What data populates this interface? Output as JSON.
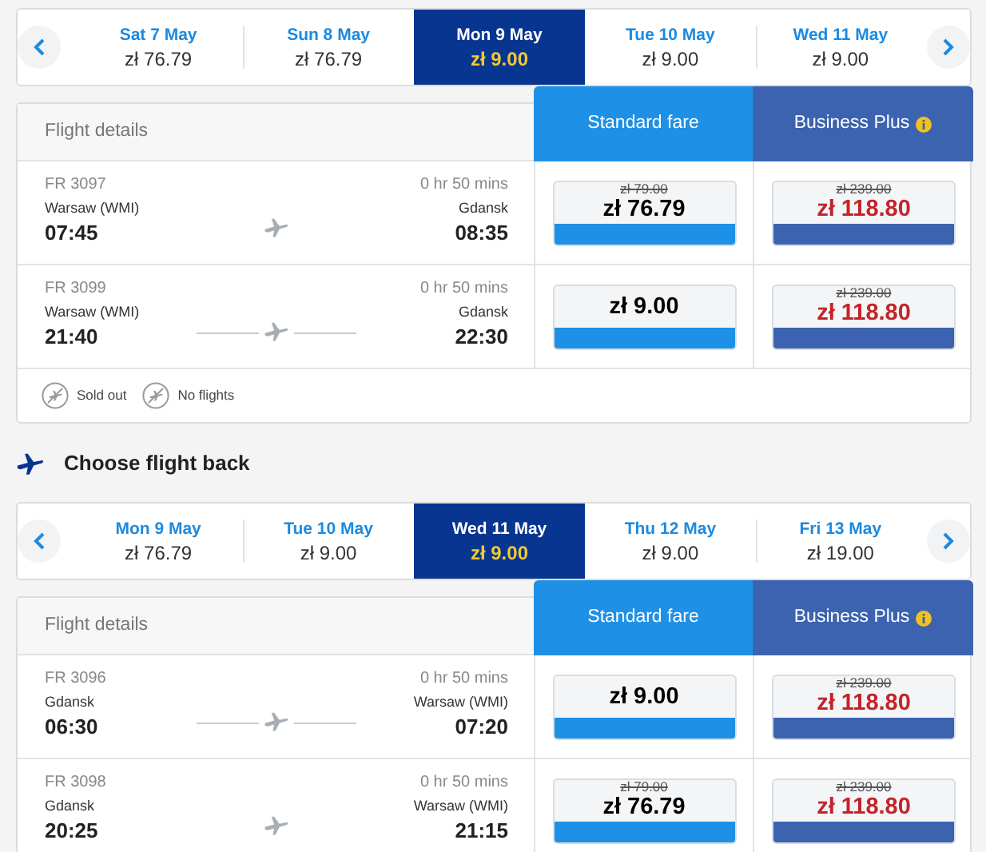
{
  "outbound": {
    "dates": [
      {
        "day": "Sat 7 May",
        "price": "zł 76.79",
        "selected": false
      },
      {
        "day": "Sun 8 May",
        "price": "zł 76.79",
        "selected": false
      },
      {
        "day": "Mon 9 May",
        "price": "zł 9.00",
        "selected": true
      },
      {
        "day": "Tue 10 May",
        "price": "zł 9.00",
        "selected": false
      },
      {
        "day": "Wed 11 May",
        "price": "zł 9.00",
        "selected": false
      }
    ],
    "details_label": "Flight details",
    "standard_label": "Standard fare",
    "business_label": "Business Plus",
    "flights": [
      {
        "number": "FR 3097",
        "from": "Warsaw (WMI)",
        "depart": "07:45",
        "duration": "0 hr 50 mins",
        "to": "Gdansk",
        "arrive": "08:35",
        "route_line": false,
        "standard": {
          "old_price": "zł 79.00",
          "price": "zł 76.79"
        },
        "business": {
          "old_price": "zł 239.00",
          "price": "zł 118.80"
        }
      },
      {
        "number": "FR 3099",
        "from": "Warsaw (WMI)",
        "depart": "21:40",
        "duration": "0 hr 50 mins",
        "to": "Gdansk",
        "arrive": "22:30",
        "route_line": true,
        "standard": {
          "price": "zł 9.00"
        },
        "business": {
          "old_price": "zł 239.00",
          "price": "zł 118.80"
        }
      }
    ],
    "legend": [
      "Sold out",
      "No flights"
    ]
  },
  "return_heading": "Choose flight back",
  "return": {
    "dates": [
      {
        "day": "Mon 9 May",
        "price": "zł 76.79",
        "selected": false
      },
      {
        "day": "Tue 10 May",
        "price": "zł 9.00",
        "selected": false
      },
      {
        "day": "Wed 11 May",
        "price": "zł 9.00",
        "selected": true
      },
      {
        "day": "Thu 12 May",
        "price": "zł 9.00",
        "selected": false
      },
      {
        "day": "Fri 13 May",
        "price": "zł 19.00",
        "selected": false
      }
    ],
    "details_label": "Flight details",
    "standard_label": "Standard fare",
    "business_label": "Business Plus",
    "flights": [
      {
        "number": "FR 3096",
        "from": "Gdansk",
        "depart": "06:30",
        "duration": "0 hr 50 mins",
        "to": "Warsaw (WMI)",
        "arrive": "07:20",
        "route_line": true,
        "standard": {
          "price": "zł 9.00"
        },
        "business": {
          "old_price": "zł 239.00",
          "price": "zł 118.80"
        }
      },
      {
        "number": "FR 3098",
        "from": "Gdansk",
        "depart": "20:25",
        "duration": "0 hr 50 mins",
        "to": "Warsaw (WMI)",
        "arrive": "21:15",
        "route_line": false,
        "standard": {
          "old_price": "zł 79.00",
          "price": "zł 76.79"
        },
        "business": {
          "old_price": "zł 239.00",
          "price": "zł 118.80"
        }
      }
    ]
  }
}
